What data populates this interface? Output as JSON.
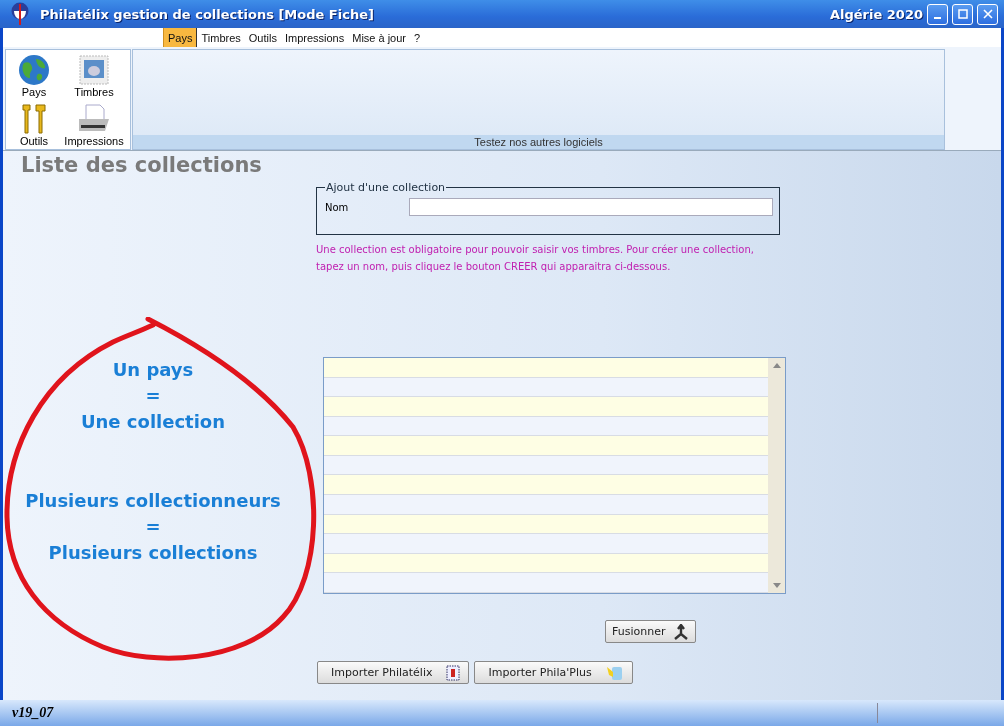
{
  "window": {
    "title": "Philatélix gestion de collections [Mode Fiche]",
    "collection": "Algérie 2020"
  },
  "menu": [
    {
      "label": "Pays",
      "selected": true
    },
    {
      "label": "Timbres",
      "selected": false
    },
    {
      "label": "Outils",
      "selected": false
    },
    {
      "label": "Impressions",
      "selected": false
    },
    {
      "label": "Mise à jour",
      "selected": false
    },
    {
      "label": "?",
      "selected": false
    }
  ],
  "toolbar": [
    {
      "label": "Pays",
      "kind": "globe"
    },
    {
      "label": "Timbres",
      "kind": "stamp"
    },
    {
      "label": "Outils",
      "kind": "tools"
    },
    {
      "label": "Impressions",
      "kind": "printer"
    }
  ],
  "banner": {
    "caption": "Testez nos autres logiciels"
  },
  "page_title": "Liste des collections",
  "form": {
    "legend": "Ajout d'une collection",
    "label": "Nom"
  },
  "hint": "Une collection est obligatoire pour pouvoir saisir vos timbres. Pour créer une collection, tapez un nom, puis cliquez le bouton CREER qui apparaitra ci-dessous.",
  "annotation": [
    "Un pays",
    "=",
    "Une collection",
    "Plusieurs collectionneurs",
    "=",
    "Plusieurs collections"
  ],
  "buttons": {
    "merge": "Fusionner",
    "import": [
      {
        "label": "Importer Philatélix",
        "kind": "philatelix"
      },
      {
        "label": "Importer Phila'Plus",
        "kind": "philaplus"
      }
    ]
  },
  "status_bar": {
    "version": "v19_07"
  }
}
